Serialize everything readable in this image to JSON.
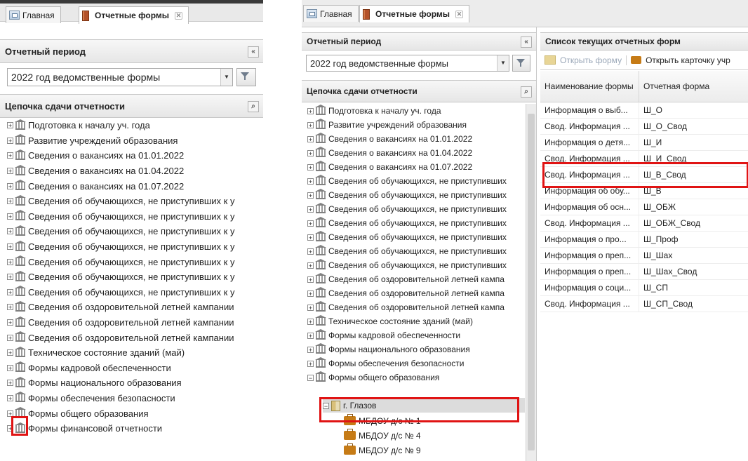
{
  "tabs": {
    "home": "Главная",
    "reports": "Отчетные формы",
    "close": "✕"
  },
  "period": {
    "title": "Отчетный период",
    "collapse": "«",
    "value": "2022 год ведомственные формы",
    "arrow": "▼"
  },
  "chain": {
    "title": "Цепочка сдачи отчетности",
    "binoculars": "⌕"
  },
  "tree_left": [
    {
      "label": "Подготовка к началу уч. года"
    },
    {
      "label": "Развитие учреждений образования"
    },
    {
      "label": "Сведения о вакансиях на 01.01.2022"
    },
    {
      "label": "Сведения о вакансиях на 01.04.2022"
    },
    {
      "label": "Сведения о вакансиях на 01.07.2022"
    },
    {
      "label": "Сведения об обучающихся, не приступивших к у"
    },
    {
      "label": "Сведения об обучающихся, не приступивших к у"
    },
    {
      "label": "Сведения об обучающихся, не приступивших к у"
    },
    {
      "label": "Сведения об обучающихся, не приступивших к у"
    },
    {
      "label": "Сведения об обучающихся, не приступивших к у"
    },
    {
      "label": "Сведения об обучающихся, не приступивших к у"
    },
    {
      "label": "Сведения об обучающихся, не приступивших к у"
    },
    {
      "label": "Сведения об оздоровительной летней кампании"
    },
    {
      "label": "Сведения об оздоровительной летней кампании"
    },
    {
      "label": "Сведения об оздоровительной летней кампании"
    },
    {
      "label": "Техническое состояние зданий (май)"
    },
    {
      "label": "Формы кадровой обеспеченности"
    },
    {
      "label": "Формы национального образования"
    },
    {
      "label": "Формы обеспечения безопасности"
    },
    {
      "label": "Формы общего образования"
    },
    {
      "label": "Формы финансовой отчетности"
    }
  ],
  "tree_right": [
    {
      "label": "Подготовка к началу уч. года"
    },
    {
      "label": "Развитие учреждений образования"
    },
    {
      "label": "Сведения о вакансиях на 01.01.2022"
    },
    {
      "label": "Сведения о вакансиях на 01.04.2022"
    },
    {
      "label": "Сведения о вакансиях на 01.07.2022"
    },
    {
      "label": "Сведения об обучающихся, не приступивших"
    },
    {
      "label": "Сведения об обучающихся, не приступивших"
    },
    {
      "label": "Сведения об обучающихся, не приступивших"
    },
    {
      "label": "Сведения об обучающихся, не приступивших"
    },
    {
      "label": "Сведения об обучающихся, не приступивших"
    },
    {
      "label": "Сведения об обучающихся, не приступивших"
    },
    {
      "label": "Сведения об обучающихся, не приступивших"
    },
    {
      "label": "Сведения об оздоровительной летней кампа"
    },
    {
      "label": "Сведения об оздоровительной летней кампа"
    },
    {
      "label": "Сведения об оздоровительной летней кампа"
    },
    {
      "label": "Техническое состояние зданий (май)"
    },
    {
      "label": "Формы кадровой обеспеченности"
    },
    {
      "label": "Формы национального образования"
    },
    {
      "label": "Формы обеспечения безопасности"
    },
    {
      "label": "Формы общего образования"
    }
  ],
  "tree_right_children": {
    "city": "г. Глазов",
    "orgs": [
      "МБДОУ д/с № 1",
      "МБДОУ д/с № 4",
      "МБДОУ д/с № 9"
    ]
  },
  "forms": {
    "title": "Список текущих отчетных форм",
    "open_form": "Открыть форму",
    "open_card": "Открыть карточку учр",
    "col_name": "Наименование формы",
    "col_form": "Отчетная форма",
    "rows": [
      {
        "name": "Информация о выб...",
        "form": "Ш_О"
      },
      {
        "name": "Свод. Информация ...",
        "form": "Ш_О_Свод"
      },
      {
        "name": "Информация о детя...",
        "form": "Ш_И"
      },
      {
        "name": "Свод. Информация ...",
        "form": "Ш_И_Свод"
      },
      {
        "name": "Свод. Информация ...",
        "form": "Ш_В_Свод"
      },
      {
        "name": "Информация об обу...",
        "form": "Ш_В"
      },
      {
        "name": "Информация об осн...",
        "form": "Ш_ОБЖ"
      },
      {
        "name": "Свод. Информация ...",
        "form": "Ш_ОБЖ_Свод"
      },
      {
        "name": "Информация о про...",
        "form": "Ш_Проф"
      },
      {
        "name": "Информация о преп...",
        "form": "Ш_Шах"
      },
      {
        "name": "Информация о преп...",
        "form": "Ш_Шах_Свод"
      },
      {
        "name": "Информация о соци...",
        "form": "Ш_СП"
      },
      {
        "name": "Свод. Информация ...",
        "form": "Ш_СП_Свод"
      }
    ]
  },
  "colors": {
    "highlight": "#e01414",
    "header_bg": "#ececec"
  }
}
